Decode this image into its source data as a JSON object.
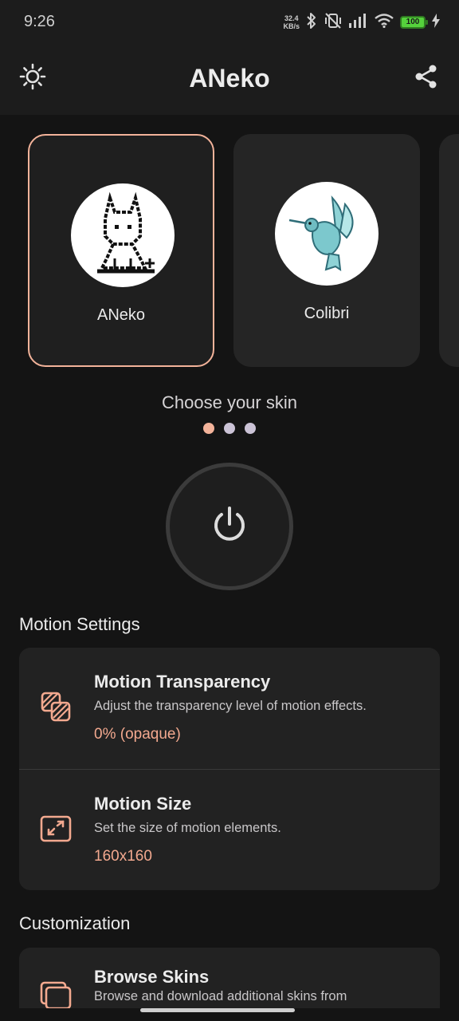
{
  "status_bar": {
    "time": "9:26",
    "net_speed_value": "32.4",
    "net_speed_unit": "KB/s",
    "battery_level": "100"
  },
  "app_bar": {
    "title": "ANeko",
    "left_icon": "brightness-icon",
    "right_icon": "share-icon"
  },
  "skins": {
    "items": [
      {
        "name": "ANeko",
        "selected": true
      },
      {
        "name": "Colibri",
        "selected": false
      }
    ],
    "choose_label": "Choose your skin",
    "page_count": 3,
    "active_page": 0
  },
  "power": {
    "icon": "power-icon"
  },
  "motion_settings": {
    "title": "Motion Settings",
    "items": [
      {
        "icon": "transparency-icon",
        "title": "Motion Transparency",
        "description": "Adjust the transparency level of motion effects.",
        "value": "0% (opaque)"
      },
      {
        "icon": "resize-icon",
        "title": "Motion Size",
        "description": "Set the size of motion elements.",
        "value": "160x160"
      }
    ]
  },
  "customization": {
    "title": "Customization",
    "items": [
      {
        "icon": "browse-skins-icon",
        "title": "Browse Skins",
        "description": "Browse and download additional skins from"
      }
    ]
  },
  "colors": {
    "accent": "#f3b39a",
    "value_text": "#f3a98f",
    "background": "#141414",
    "card": "#222222"
  }
}
